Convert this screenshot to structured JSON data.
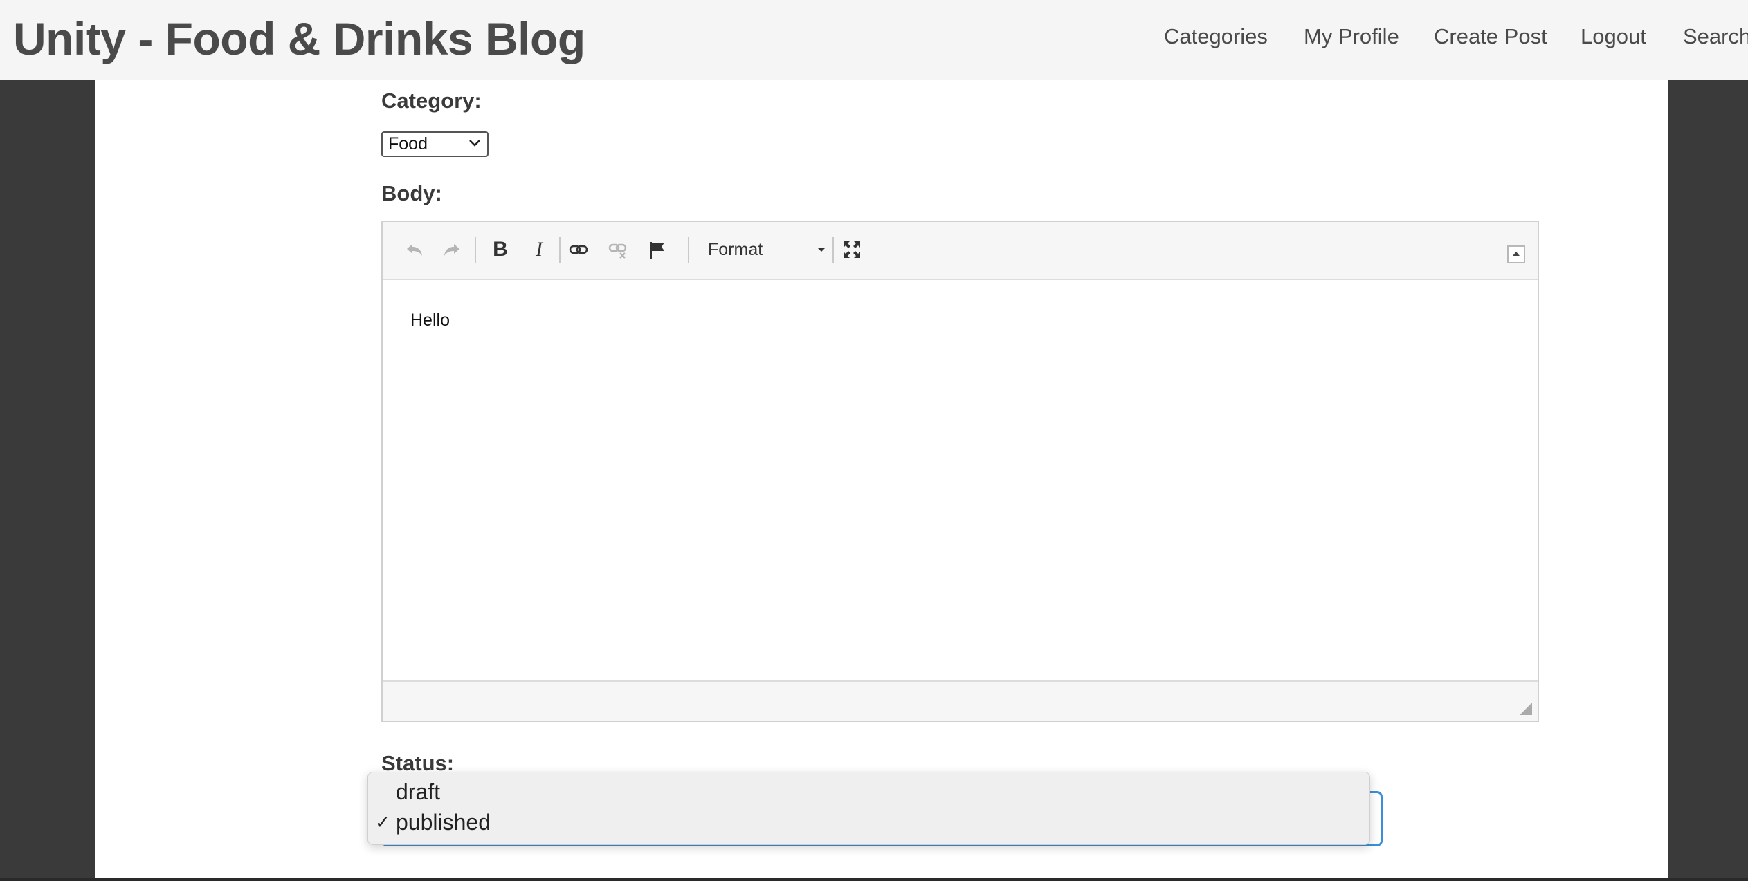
{
  "header": {
    "title": "Unity - Food & Drinks Blog",
    "nav": [
      "Categories",
      "My Profile",
      "Create Post",
      "Logout",
      "Search"
    ]
  },
  "form": {
    "category_label": "Category:",
    "category_value": "Food",
    "body_label": "Body:",
    "status_label": "Status:"
  },
  "editor": {
    "toolbar": {
      "undo_icon": "undo-icon",
      "redo_icon": "redo-icon",
      "bold_glyph": "B",
      "italic_glyph": "I",
      "format_label": "Format"
    },
    "content": "Hello"
  },
  "status_dropdown": {
    "options": [
      {
        "label": "draft",
        "selected": false
      },
      {
        "label": "published",
        "selected": true
      }
    ],
    "check_glyph": "✓"
  },
  "colors": {
    "header_bg": "#f5f5f5",
    "page_bg": "#3a3a3a",
    "focus_ring": "#3b8fd9"
  }
}
